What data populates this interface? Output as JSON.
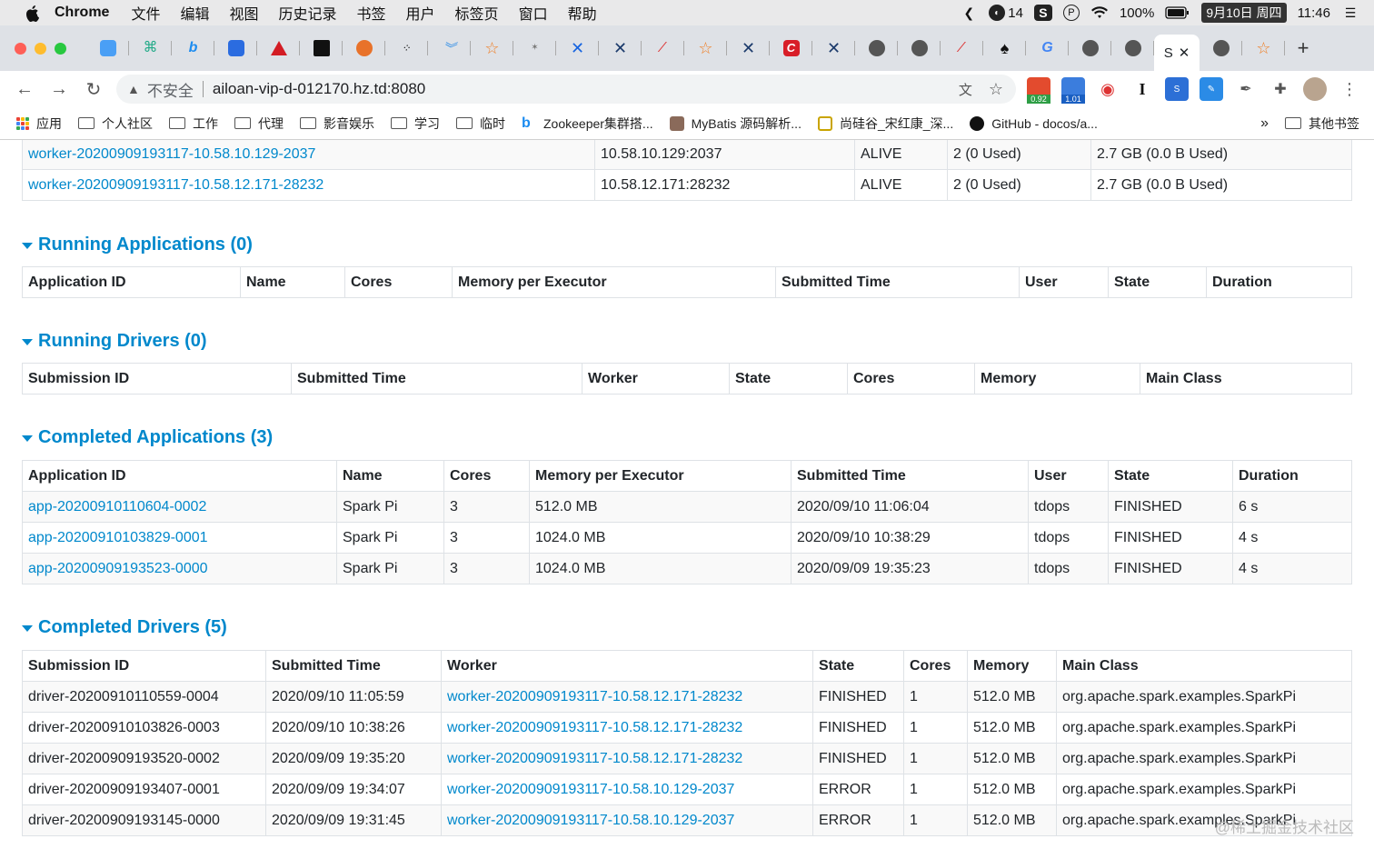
{
  "menubar": {
    "app": "Chrome",
    "items": [
      "文件",
      "编辑",
      "视图",
      "历史记录",
      "书签",
      "用户",
      "标签页",
      "窗口",
      "帮助"
    ],
    "status": {
      "notif_count": "14",
      "battery": "100%",
      "date": "9月10日 周四",
      "time": "11:46"
    }
  },
  "tabs": {
    "active_label": "S"
  },
  "toolbar": {
    "insecure_label": "不安全",
    "url": "ailoan-vip-d-012170.hz.td:8080",
    "ext_badges": [
      "0.92",
      "1.01"
    ]
  },
  "bookmarks": {
    "apps": "应用",
    "items": [
      "个人社区",
      "工作",
      "代理",
      "影音娱乐",
      "学习",
      "临时"
    ],
    "links": [
      "Zookeeper集群搭...",
      "MyBatis 源码解析...",
      "尚硅谷_宋红康_深...",
      "GitHub - docos/a..."
    ],
    "more": "»",
    "other": "其他书签"
  },
  "workers": {
    "rows": [
      {
        "id": "worker-20200909193117-10.58.10.129-2037",
        "address": "10.58.10.129:2037",
        "state": "ALIVE",
        "cores": "2 (0 Used)",
        "memory": "2.7 GB (0.0 B Used)"
      },
      {
        "id": "worker-20200909193117-10.58.12.171-28232",
        "address": "10.58.12.171:28232",
        "state": "ALIVE",
        "cores": "2 (0 Used)",
        "memory": "2.7 GB (0.0 B Used)"
      }
    ]
  },
  "running_apps": {
    "title": "Running Applications (0)",
    "headers": [
      "Application ID",
      "Name",
      "Cores",
      "Memory per Executor",
      "Submitted Time",
      "User",
      "State",
      "Duration"
    ]
  },
  "running_drivers": {
    "title": "Running Drivers (0)",
    "headers": [
      "Submission ID",
      "Submitted Time",
      "Worker",
      "State",
      "Cores",
      "Memory",
      "Main Class"
    ]
  },
  "completed_apps": {
    "title": "Completed Applications (3)",
    "headers": [
      "Application ID",
      "Name",
      "Cores",
      "Memory per Executor",
      "Submitted Time",
      "User",
      "State",
      "Duration"
    ],
    "rows": [
      {
        "id": "app-20200910110604-0002",
        "name": "Spark Pi",
        "cores": "3",
        "mem": "512.0 MB",
        "submitted": "2020/09/10 11:06:04",
        "user": "tdops",
        "state": "FINISHED",
        "duration": "6 s"
      },
      {
        "id": "app-20200910103829-0001",
        "name": "Spark Pi",
        "cores": "3",
        "mem": "1024.0 MB",
        "submitted": "2020/09/10 10:38:29",
        "user": "tdops",
        "state": "FINISHED",
        "duration": "4 s"
      },
      {
        "id": "app-20200909193523-0000",
        "name": "Spark Pi",
        "cores": "3",
        "mem": "1024.0 MB",
        "submitted": "2020/09/09 19:35:23",
        "user": "tdops",
        "state": "FINISHED",
        "duration": "4 s"
      }
    ]
  },
  "completed_drivers": {
    "title": "Completed Drivers (5)",
    "headers": [
      "Submission ID",
      "Submitted Time",
      "Worker",
      "State",
      "Cores",
      "Memory",
      "Main Class"
    ],
    "rows": [
      {
        "id": "driver-20200910110559-0004",
        "submitted": "2020/09/10 11:05:59",
        "worker": "worker-20200909193117-10.58.12.171-28232",
        "state": "FINISHED",
        "cores": "1",
        "mem": "512.0 MB",
        "main": "org.apache.spark.examples.SparkPi"
      },
      {
        "id": "driver-20200910103826-0003",
        "submitted": "2020/09/10 10:38:26",
        "worker": "worker-20200909193117-10.58.12.171-28232",
        "state": "FINISHED",
        "cores": "1",
        "mem": "512.0 MB",
        "main": "org.apache.spark.examples.SparkPi"
      },
      {
        "id": "driver-20200909193520-0002",
        "submitted": "2020/09/09 19:35:20",
        "worker": "worker-20200909193117-10.58.12.171-28232",
        "state": "FINISHED",
        "cores": "1",
        "mem": "512.0 MB",
        "main": "org.apache.spark.examples.SparkPi"
      },
      {
        "id": "driver-20200909193407-0001",
        "submitted": "2020/09/09 19:34:07",
        "worker": "worker-20200909193117-10.58.10.129-2037",
        "state": "ERROR",
        "cores": "1",
        "mem": "512.0 MB",
        "main": "org.apache.spark.examples.SparkPi"
      },
      {
        "id": "driver-20200909193145-0000",
        "submitted": "2020/09/09 19:31:45",
        "worker": "worker-20200909193117-10.58.10.129-2037",
        "state": "ERROR",
        "cores": "1",
        "mem": "512.0 MB",
        "main": "org.apache.spark.examples.SparkPi"
      }
    ]
  },
  "watermark": "@稀土掘金技术社区"
}
